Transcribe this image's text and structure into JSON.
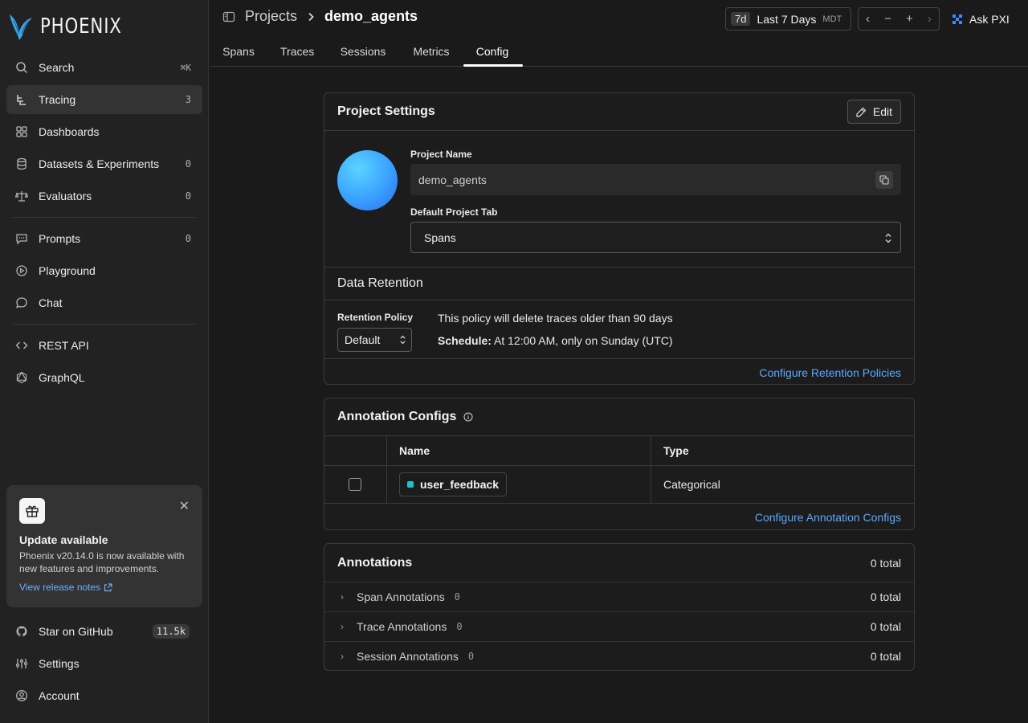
{
  "app": {
    "logo_text": "PHOENIX"
  },
  "sidebar": {
    "items": [
      {
        "label": "Search",
        "shortcut": "⌘K",
        "icon": "search-icon"
      },
      {
        "label": "Tracing",
        "count": "3",
        "icon": "tracing-icon"
      },
      {
        "label": "Dashboards",
        "icon": "grid-icon"
      },
      {
        "label": "Datasets & Experiments",
        "count": "0",
        "icon": "database-icon"
      },
      {
        "label": "Evaluators",
        "count": "0",
        "icon": "scale-icon"
      },
      {
        "label": "Prompts",
        "count": "0",
        "icon": "message-square-icon"
      },
      {
        "label": "Playground",
        "icon": "play-circle-icon"
      },
      {
        "label": "Chat",
        "icon": "chat-bubble-icon"
      },
      {
        "label": "REST API",
        "icon": "code-icon"
      },
      {
        "label": "GraphQL",
        "icon": "graphql-icon"
      }
    ],
    "update": {
      "title": "Update available",
      "body": "Phoenix v20.14.0 is now available with new features and improvements.",
      "link": "View release notes"
    },
    "footer": [
      {
        "label": "Star on GitHub",
        "badge": "11.5k",
        "icon": "github-icon"
      },
      {
        "label": "Settings",
        "icon": "sliders-icon"
      },
      {
        "label": "Account",
        "icon": "user-circle-icon"
      }
    ]
  },
  "header": {
    "breadcrumb": [
      "Projects",
      "demo_agents"
    ],
    "time_chip": "7d",
    "time_label": "Last 7 Days",
    "timezone": "MDT",
    "ask": "Ask PXI"
  },
  "tabs": [
    "Spans",
    "Traces",
    "Sessions",
    "Metrics",
    "Config"
  ],
  "active_tab": "Config",
  "project_settings": {
    "title": "Project Settings",
    "edit": "Edit",
    "name_label": "Project Name",
    "name_value": "demo_agents",
    "tab_label": "Default Project Tab",
    "tab_value": "Spans"
  },
  "retention": {
    "title": "Data Retention",
    "policy_label": "Retention Policy",
    "policy_value": "Default",
    "description": "This policy will delete traces older than 90 days",
    "schedule_label": "Schedule:",
    "schedule_value": "At 12:00 AM, only on Sunday (UTC)",
    "link": "Configure Retention Policies"
  },
  "annotation_configs": {
    "title": "Annotation Configs",
    "columns": [
      "Name",
      "Type"
    ],
    "rows": [
      {
        "name": "user_feedback",
        "type": "Categorical",
        "color": "#1fc2c2"
      }
    ],
    "link": "Configure Annotation Configs"
  },
  "annotations": {
    "title": "Annotations",
    "total": "0 total",
    "rows": [
      {
        "label": "Span Annotations",
        "count": "0",
        "total": "0 total"
      },
      {
        "label": "Trace Annotations",
        "count": "0",
        "total": "0 total"
      },
      {
        "label": "Session Annotations",
        "count": "0",
        "total": "0 total"
      }
    ]
  }
}
